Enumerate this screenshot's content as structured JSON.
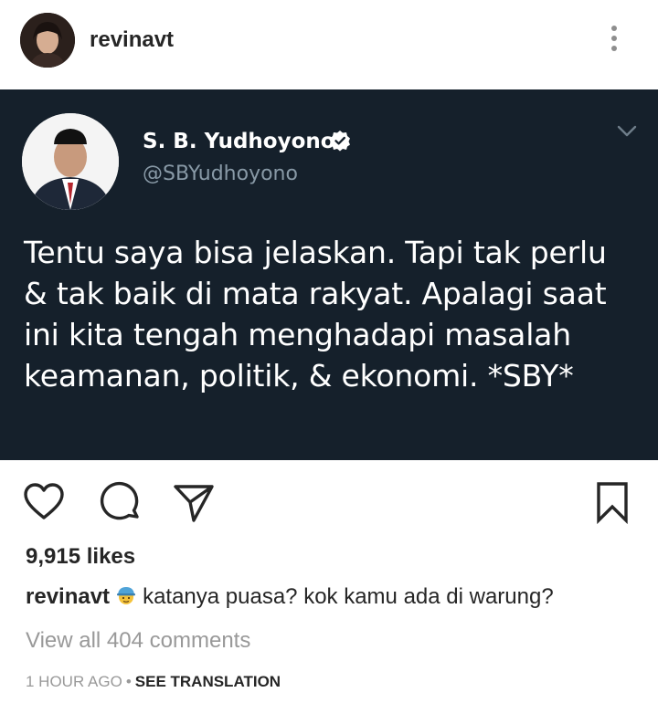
{
  "post": {
    "username": "revinavt",
    "tweet": {
      "name": "S. B. Yudhoyono",
      "handle": "@SBYudhoyono",
      "lines": [
        "Tentu saya bisa jelaskan. Tapi tak perlu",
        "& tak baik di mata rakyat. Apalagi saat",
        "ini kita tengah menghadapi masalah",
        "keamanan, politik, & ekonomi. *SBY*"
      ]
    },
    "likes": "9,915 likes",
    "caption": {
      "username": "revinavt",
      "text": "katanya puasa? kok kamu ada di warung?"
    },
    "view_all": "View all 404 comments",
    "time": "1 HOUR AGO",
    "separator": "•",
    "see_translation": "SEE TRANSLATION"
  },
  "icons": {
    "more": "more-vertical-icon",
    "like": "heart-outline-icon",
    "comment": "comment-bubble-icon",
    "share": "paper-plane-icon",
    "save": "bookmark-outline-icon",
    "verified": "verified-badge-icon",
    "chevron": "chevron-down-icon",
    "emoji": "construction-worker-emoji"
  },
  "colors": {
    "tweet_bg": "#15202b",
    "handle": "#8899a6",
    "muted": "#999999"
  }
}
